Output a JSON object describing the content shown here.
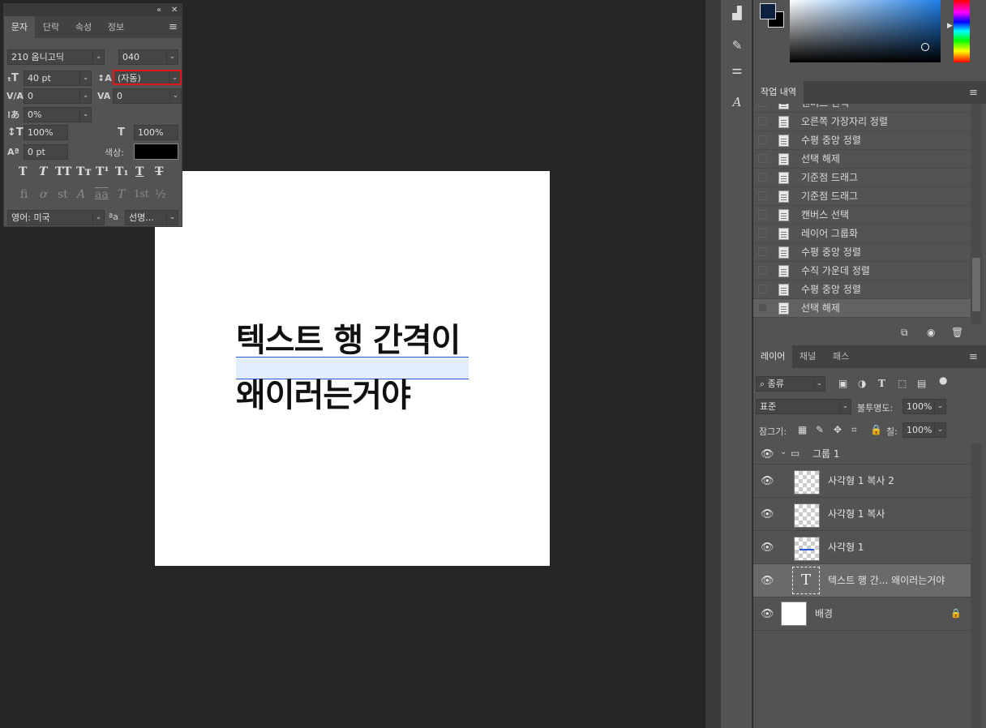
{
  "canvas": {
    "line1": "텍스트 행 간격이",
    "line2": "왜이러는거야"
  },
  "char_panel": {
    "tabs": [
      "문자",
      "단락",
      "속성",
      "정보"
    ],
    "active_tab": "문자",
    "font_family": "210 옴니고딕",
    "font_style": "040",
    "font_size": "40 pt",
    "leading": "(자동)",
    "kerning": "0",
    "tracking": "0",
    "tsume": "0%",
    "vertical_scale": "100%",
    "horizontal_scale": "100%",
    "baseline_shift": "0 pt",
    "color_label": "색상:",
    "text_color": "#000000",
    "language": "영어: 미국",
    "antialias": "선명...",
    "antialias_icon": "ªa",
    "style_glyphs": [
      "T",
      "T",
      "TT",
      "Tт",
      "T¹",
      "T₁",
      "T",
      "T"
    ],
    "opentype_glyphs": [
      "fi",
      "ơ",
      "st",
      "A",
      "aa",
      "T",
      "1st",
      "½"
    ]
  },
  "color_panel": {
    "foreground": "#0d2240",
    "background": "#000000"
  },
  "history": {
    "tab": "작업 내역",
    "items": [
      "캔버스 선택",
      "오른쪽 가장자리 정렬",
      "수평 중앙 정렬",
      "선택 해제",
      "기준점 드래그",
      "기준점 드래그",
      "캔버스 선택",
      "레이어 그룹화",
      "수평 중앙 정렬",
      "수직 가운데 정렬",
      "수평 중앙 정렬",
      "선택 해제"
    ]
  },
  "layers": {
    "tabs": [
      "레이어",
      "채널",
      "패스"
    ],
    "filter_kind": "종류",
    "blend_mode": "표준",
    "opacity_label": "불투명도:",
    "opacity": "100%",
    "lock_label": "잠그기:",
    "fill_label": "칠:",
    "fill": "100%",
    "group_name": "그룹 1",
    "items": [
      {
        "name": "사각형 1 복사 2"
      },
      {
        "name": "사각형 1 복사"
      },
      {
        "name": "사각형 1"
      },
      {
        "name": "텍스트 행 간... 왜이러는거야"
      },
      {
        "name": "배경"
      }
    ],
    "text_thumb_glyph": "T"
  }
}
